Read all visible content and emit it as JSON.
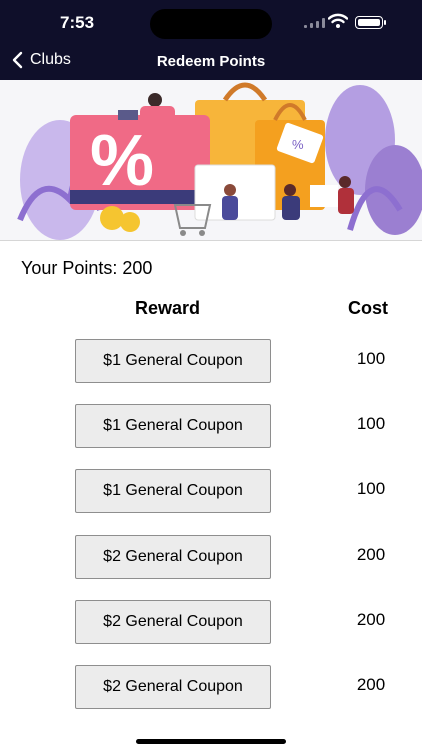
{
  "status": {
    "time": "7:53"
  },
  "nav": {
    "back_label": "Clubs",
    "title": "Redeem Points"
  },
  "points": {
    "label": "Your Points: 200"
  },
  "table": {
    "reward_header": "Reward",
    "cost_header": "Cost",
    "rows": [
      {
        "reward": "$1 General Coupon",
        "cost": "100"
      },
      {
        "reward": "$1 General Coupon",
        "cost": "100"
      },
      {
        "reward": "$1 General Coupon",
        "cost": "100"
      },
      {
        "reward": "$2 General Coupon",
        "cost": "200"
      },
      {
        "reward": "$2 General Coupon",
        "cost": "200"
      },
      {
        "reward": "$2 General Coupon",
        "cost": "200"
      }
    ]
  },
  "banner": {
    "sign_text": "%",
    "tag_text": "%"
  },
  "colors": {
    "nav_bg": "#0f0f2a",
    "button_bg": "#ececec",
    "banner_pink": "#f06a86",
    "banner_yellow": "#f7b53a",
    "banner_purple": "#9b7fd1"
  }
}
